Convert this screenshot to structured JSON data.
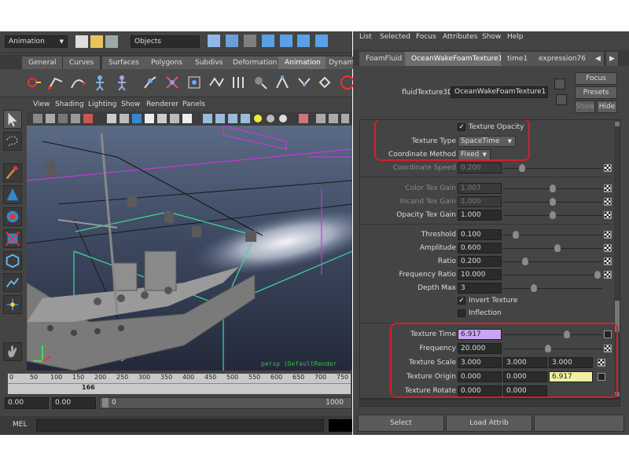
{
  "colors": {
    "accent_red": "#d4202a",
    "keyed_field": "#c9a6f2",
    "highlight_field": "#eef0a2",
    "viewport_sky": "#5b6a85"
  },
  "maya": {
    "menu_set": "Animation",
    "objects_field": "Objects",
    "shelf_tabs": [
      "General",
      "Curves",
      "Surfaces",
      "Polygons",
      "Subdivs",
      "Deformation",
      "Animation",
      "Dynam"
    ],
    "active_shelf_tab": "Animation",
    "viewport_menu": [
      "View",
      "Shading",
      "Lighting",
      "Show",
      "Renderer",
      "Panels"
    ],
    "viewport_caption": "persp (DefaultRender",
    "timeline_ticks": [
      "0",
      "50",
      "100",
      "150",
      "200",
      "250",
      "300",
      "350",
      "400",
      "450",
      "500",
      "550",
      "600",
      "650",
      "700",
      "750"
    ],
    "current_frame": "166",
    "range_start": "0.00",
    "range_start2": "0.00",
    "range_slider_value": "0",
    "range_end": "1000",
    "command_line_label": "MEL"
  },
  "attr_editor": {
    "menu": [
      "List",
      "Selected",
      "Focus",
      "Attributes",
      "Show",
      "Help"
    ],
    "tabs": [
      "FoamFluid",
      "OceanWakeFoamTexture1",
      "time1",
      "expression76"
    ],
    "active_tab": "OceanWakeFoamTexture1",
    "node_type_label": "fluidTexture3D:",
    "node_name": "OceanWakeFoamTexture1",
    "focus_button": "Focus",
    "presets_button": "Presets",
    "show_button": "Show",
    "hide_button": "Hide",
    "texture_opacity_label": "Texture Opacity",
    "texture_type_label": "Texture Type",
    "texture_type_value": "SpaceTime",
    "coordinate_method_label": "Coordinate Method",
    "coordinate_method_value": "Fixed",
    "coordinate_speed": {
      "label": "Coordinate Speed",
      "value": "0.200"
    },
    "gains": [
      {
        "label": "Color Tex Gain",
        "value": "1.007",
        "level": 0.5
      },
      {
        "label": "Incand Tex Gain",
        "value": "1.000",
        "level": 0.5
      },
      {
        "label": "Opacity Tex Gain",
        "value": "1.000",
        "level": 0.5
      }
    ],
    "noise": [
      {
        "label": "Threshold",
        "value": "0.100",
        "level": 0.1
      },
      {
        "label": "Amplitude",
        "value": "0.600",
        "level": 0.55
      },
      {
        "label": "Ratio",
        "value": "0.200",
        "level": 0.2
      },
      {
        "label": "Frequency Ratio",
        "value": "10.000",
        "level": 0.98
      },
      {
        "label": "Depth Max",
        "value": "3",
        "level": 0.3
      }
    ],
    "invert_texture_label": "Invert Texture",
    "inflection_label": "Inflection",
    "texture_time": {
      "label": "Texture Time",
      "value": "6.917",
      "level": 0.65
    },
    "frequency": {
      "label": "Frequency",
      "value": "20.000",
      "level": 0.45
    },
    "texture_scale": {
      "label": "Texture Scale",
      "x": "3.000",
      "y": "3.000",
      "z": "3.000"
    },
    "texture_origin": {
      "label": "Texture Origin",
      "x": "0.000",
      "y": "0.000",
      "z": "6.917"
    },
    "texture_rotate": {
      "label": "Texture Rotate",
      "x": "0.000",
      "y": "0.000"
    },
    "select_button": "Select",
    "load_button": "Load Attrib"
  }
}
